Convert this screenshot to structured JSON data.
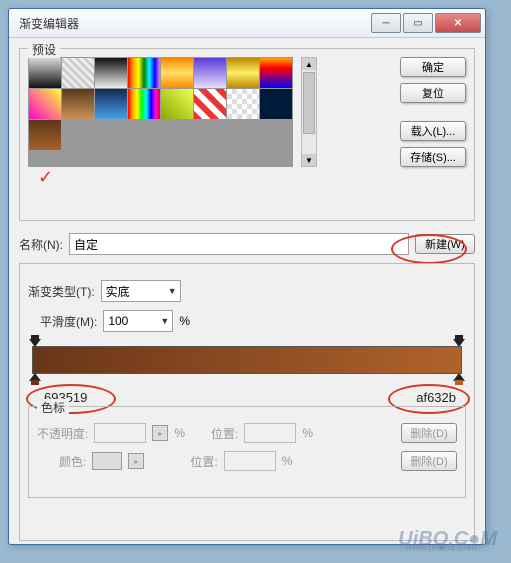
{
  "window": {
    "title": "渐变编辑器"
  },
  "buttons": {
    "ok": "确定",
    "reset": "复位",
    "load": "载入(L)...",
    "save": "存储(S)...",
    "new": "新建(W)",
    "delete": "删除(D)"
  },
  "labels": {
    "preset": "预设",
    "name": "名称(N):",
    "gtype": "渐变类型(T):",
    "smooth": "平滑度(M):",
    "stops": "色标",
    "opacity": "不透明度:",
    "position": "位置:",
    "color": "颜色:",
    "pct": "%"
  },
  "values": {
    "name": "自定",
    "gtype": "实底",
    "smooth": "100"
  },
  "hex": {
    "left": "693519",
    "right": "af632b"
  },
  "swatches": [
    [
      "linear-gradient(#d8d8d8,#111)",
      "linear-gradient(45deg,#eee 25%,#ccc 25%,#ccc 50%,#eee 50%,#eee 75%,#ccc 75%) 0 0/8px 8px,linear-gradient(#000,transparent)",
      "linear-gradient(#111,#eee)",
      "linear-gradient(90deg,red,orange,yellow,green,cyan,blue,violet)",
      "linear-gradient(#ff8800,#ffe066,#ff8800)",
      "linear-gradient(#5a3bd6,#e8dcff)",
      "linear-gradient(#b80,#fe6,#b80)",
      "linear-gradient(orange,red,purple,blue)"
    ],
    [
      "linear-gradient(45deg,#ff00cc,#ffff33)",
      "linear-gradient(#5a3a1a,#c99258)",
      "linear-gradient(#102a58,#4aa0e8)",
      "linear-gradient(90deg,red,orange,yellow,lime,cyan,blue,magenta,red)",
      "linear-gradient(45deg,#8a0,#ef5)",
      "repeating-linear-gradient(45deg,#e33 0 6px,#fff 6px 12px)",
      "repeating-conic-gradient(#ddd 0 25%,#fff 0 50%) 0 0/10px 10px",
      "linear-gradient(#001a3a,#001a3a)"
    ],
    [
      "linear-gradient(#5a371a,#a8622b)"
    ]
  ],
  "watermark": "UiBQ.C●M",
  "smalltext": "www.psanz.com"
}
